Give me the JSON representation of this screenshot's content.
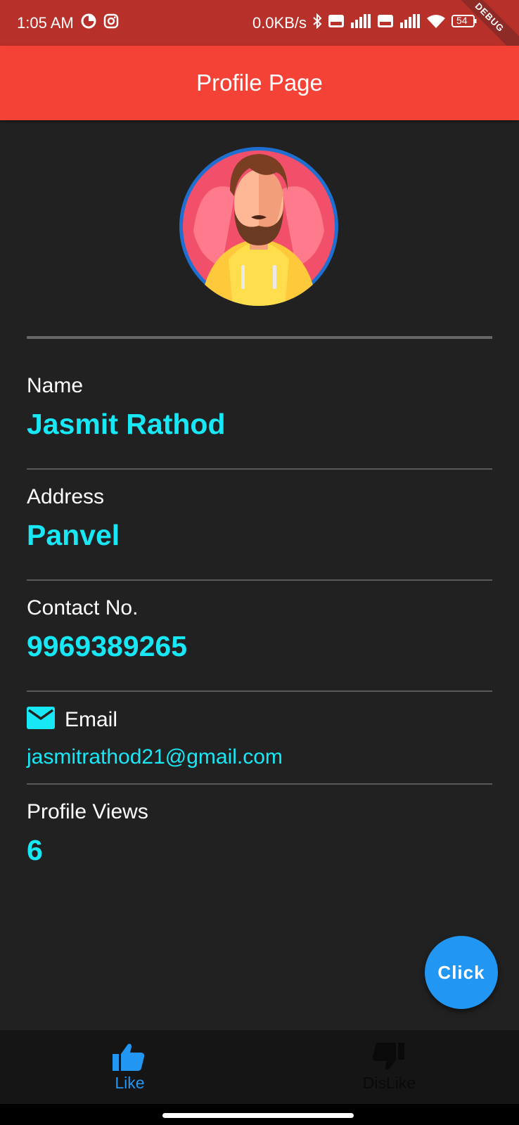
{
  "status_bar": {
    "time": "1:05 AM",
    "net_speed": "0.0KB/s",
    "battery": "54",
    "debug_label": "DEBUG",
    "icons": [
      "data-saver-icon",
      "instagram-icon",
      "bluetooth-icon",
      "volte-icon",
      "signal-icon",
      "wifi-icon",
      "battery-icon",
      "charging-icon"
    ]
  },
  "app_bar": {
    "title": "Profile Page"
  },
  "profile": {
    "name_label": "Name",
    "name": "Jasmit Rathod",
    "address_label": "Address",
    "address": "Panvel",
    "contact_label": "Contact No.",
    "contact": "9969389265",
    "email_label": "Email",
    "email": "jasmitrathod21@gmail.com",
    "views_label": "Profile Views",
    "views": "6"
  },
  "fab": {
    "label": "Click"
  },
  "bottom_nav": {
    "items": [
      {
        "label": "Like",
        "icon": "thumb-up-icon",
        "active": true
      },
      {
        "label": "DisLike",
        "icon": "thumb-down-icon",
        "active": false
      }
    ]
  },
  "colors": {
    "status_bar": "#b73029",
    "app_bar": "#f44336",
    "background": "#212121",
    "accent_text": "#18e7f5",
    "fab": "#2196f3",
    "nav_active": "#2196f3",
    "nav_inactive": "#0a0a0a"
  }
}
